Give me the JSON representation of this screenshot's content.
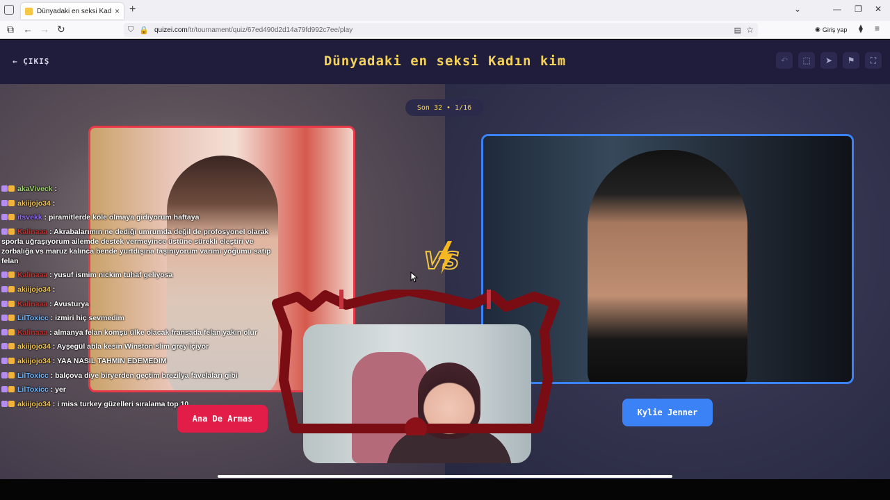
{
  "browser": {
    "tab_title": "Dünyadaki en seksi Kadın kim -",
    "url_domain": "quizei.com",
    "url_path": "/tr/tournament/quiz/67ed490d2d14a79fd992c7ee/play",
    "signin_label": "Giriş yap"
  },
  "header": {
    "exit_label": "ÇIKIŞ",
    "title": "Dünyadaki en seksi Kadın kim",
    "tools": [
      "undo-icon",
      "share-icon",
      "send-icon",
      "flag-icon",
      "fullscreen-icon"
    ]
  },
  "round": {
    "label": "Son 32 • 1/16"
  },
  "contestants": {
    "left": {
      "name": "Ana De Armas",
      "color": "#e11d48"
    },
    "right": {
      "name": "Kylie Jenner",
      "color": "#3b82f6"
    }
  },
  "vs_label": "VS",
  "chat": [
    {
      "user": "akaViveck",
      "text": " :",
      "color": "#9cd46a"
    },
    {
      "user": "akiijojo34",
      "text": " :",
      "color": "#f3c449"
    },
    {
      "user": "itsvekk",
      "text": " : piramitlerde köle olmaya gidiyorum haftaya",
      "color": "#8e6cf0"
    },
    {
      "user": "Kalinaaa",
      "text": " : Akrabalarımın ne dediği umrumda değil de profosyonel olarak sporla uğraşıyorum ailemde destek vermeyince üstüne sürekli eleştiri ve zorbalığa vs maruz kalınca bende yurtdışına taşınıyorum varımı yoğumu satıp felan",
      "color": "#c9302c"
    },
    {
      "user": "Kalinaaa",
      "text": " : yusuf ismim nickim tuhaf geliyosa",
      "color": "#c9302c"
    },
    {
      "user": "akiijojo34",
      "text": " :",
      "color": "#f3c449"
    },
    {
      "user": "Kalinaaa",
      "text": " : Avusturya",
      "color": "#c9302c"
    },
    {
      "user": "LilToxicc",
      "text": " : izmiri hiç sevmedim",
      "color": "#6fb7ff"
    },
    {
      "user": "Kalinaaa",
      "text": " : almanya felan komşu ülke olacak fransada felan yakın olur",
      "color": "#c9302c"
    },
    {
      "user": "akiijojo34",
      "text": " : Ayşegül abla kesin Winston slim grey içiyor",
      "color": "#f3c449"
    },
    {
      "user": "akiijojo34",
      "text": " : YAA NASIL TAHMIN EDEMEDIM",
      "color": "#f3c449"
    },
    {
      "user": "LilToxicc",
      "text": " : balçova diye biryerden geçtim brezilya favelaları gibi",
      "color": "#6fb7ff"
    },
    {
      "user": "LilToxicc",
      "text": " : yer",
      "color": "#6fb7ff"
    },
    {
      "user": "akiijojo34",
      "text": " : i miss turkey güzelleri sıralama top 10",
      "color": "#f3c449"
    }
  ]
}
